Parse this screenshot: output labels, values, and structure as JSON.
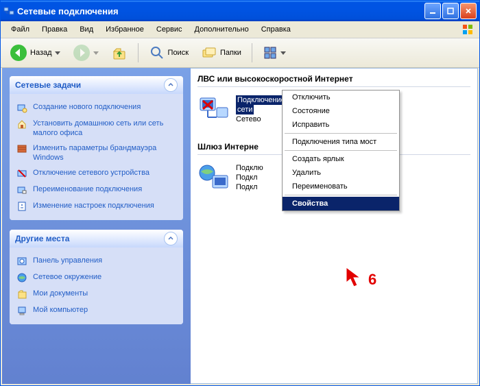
{
  "window": {
    "title": "Сетевые подключения"
  },
  "menubar": [
    "Файл",
    "Правка",
    "Вид",
    "Избранное",
    "Сервис",
    "Дополнительно",
    "Справка"
  ],
  "toolbar": {
    "back": "Назад",
    "search": "Поиск",
    "folders": "Папки"
  },
  "sidebar": {
    "panel1": {
      "title": "Сетевые задачи",
      "tasks": [
        {
          "label": "Создание нового подключения"
        },
        {
          "label": "Установить домашнюю сеть или сеть малого офиса"
        },
        {
          "label": "Изменить параметры брандмауэра Windows"
        },
        {
          "label": "Отключение сетевого устройства"
        },
        {
          "label": "Переименование подключения"
        },
        {
          "label": "Изменение настроек подключения"
        }
      ]
    },
    "panel2": {
      "title": "Другие места",
      "tasks": [
        {
          "label": "Панель управления"
        },
        {
          "label": "Сетевое окружение"
        },
        {
          "label": "Мои документы"
        },
        {
          "label": "Мой компьютер"
        }
      ]
    }
  },
  "content": {
    "group1": "ЛВС или высокоскоростной Интернет",
    "conn1_line1": "Подключение по локальной",
    "conn1_line2": "сети",
    "conn1_line3": "Сетево",
    "group2": "Шлюз Интерне",
    "conn2_line1": "Подклю",
    "conn2_line2": "Подкл",
    "conn2_line3": "Подкл"
  },
  "ctx": {
    "items": [
      "Отключить",
      "Состояние",
      "Исправить",
      "Подключения типа мост",
      "Создать ярлык",
      "Удалить",
      "Переименовать",
      "Свойства"
    ],
    "highlight": 7
  },
  "callout": "6"
}
